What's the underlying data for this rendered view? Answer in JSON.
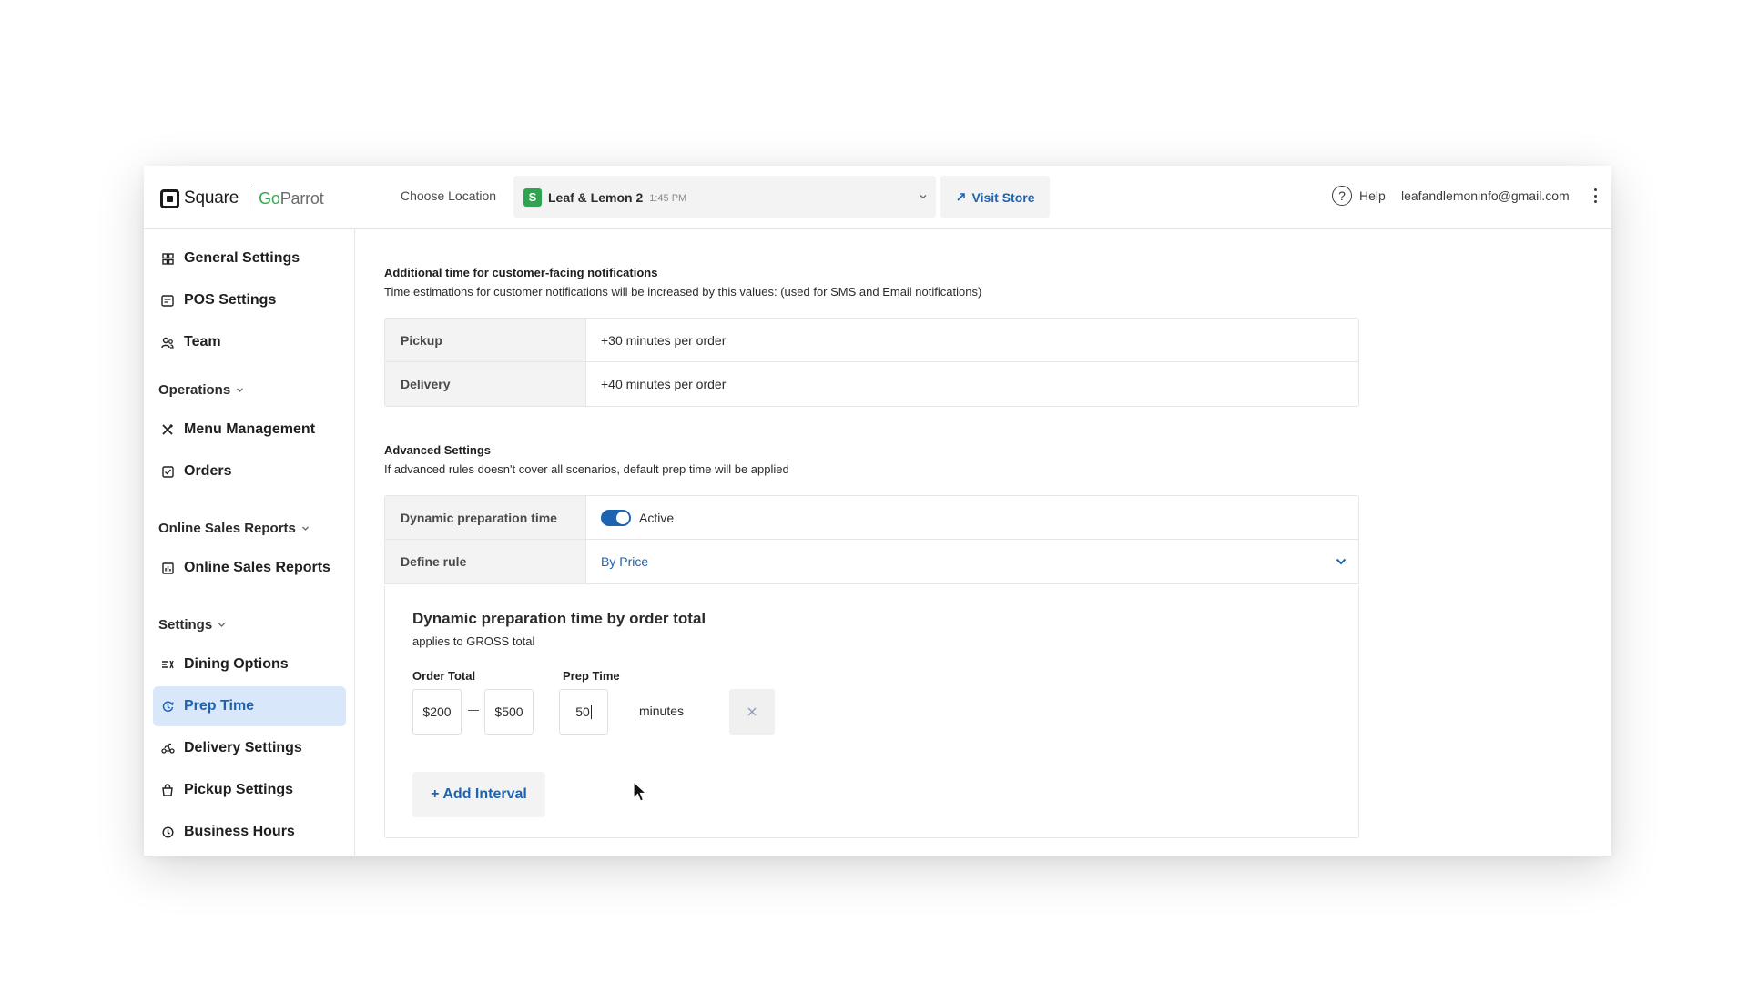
{
  "brand": {
    "square": "Square",
    "goparrot_go": "Go",
    "goparrot_rest": "Parrot"
  },
  "header": {
    "choose_location_label": "Choose Location",
    "location": {
      "badge": "S",
      "name": "Leaf & Lemon 2",
      "time": "1:45 PM"
    },
    "visit_store": "Visit Store",
    "help": "Help",
    "user_email": "leafandlemoninfo@gmail.com"
  },
  "sidebar": {
    "top_items": [
      {
        "label": "General Settings",
        "icon": "grid-icon"
      },
      {
        "label": "POS Settings",
        "icon": "pos-icon"
      },
      {
        "label": "Team",
        "icon": "team-icon"
      }
    ],
    "sections": [
      {
        "title": "Operations",
        "items": [
          {
            "label": "Menu Management",
            "icon": "utensils-icon"
          },
          {
            "label": "Orders",
            "icon": "checkbox-icon"
          }
        ]
      },
      {
        "title": "Online Sales Reports",
        "items": [
          {
            "label": "Online Sales Reports",
            "icon": "report-icon"
          }
        ]
      },
      {
        "title": "Settings",
        "items": [
          {
            "label": "Dining Options",
            "icon": "dining-icon"
          },
          {
            "label": "Prep Time",
            "icon": "clock-icon",
            "active": true
          },
          {
            "label": "Delivery Settings",
            "icon": "delivery-icon"
          },
          {
            "label": "Pickup Settings",
            "icon": "pickup-icon"
          },
          {
            "label": "Business Hours",
            "icon": "business-hours-icon"
          }
        ]
      }
    ]
  },
  "notifications": {
    "title": "Additional time for customer-facing notifications",
    "description": "Time estimations for customer notifications will be increased by this values: (used for SMS and Email notifications)",
    "rows": [
      {
        "label": "Pickup",
        "value": "+30 minutes per order"
      },
      {
        "label": "Delivery",
        "value": "+40 minutes per order"
      }
    ]
  },
  "advanced": {
    "title": "Advanced Settings",
    "description": "If advanced rules doesn't cover all scenarios, default prep time will be applied",
    "dynamic_label": "Dynamic preparation time",
    "dynamic_state": "Active",
    "dynamic_enabled": true,
    "rule_label": "Define rule",
    "rule_value": "By Price"
  },
  "rule": {
    "title": "Dynamic preparation time by order total",
    "subtitle": "applies to GROSS total",
    "order_total_label": "Order Total",
    "prep_time_label": "Prep Time",
    "interval": {
      "from": "$200",
      "to": "$500",
      "prep": "50",
      "unit": "minutes"
    },
    "add_interval": "+ Add Interval"
  },
  "colors": {
    "accent": "#1d63b0",
    "active_bg": "#d9e7fb",
    "location_badge": "#2ea44f",
    "brand_go": "#34a853"
  }
}
